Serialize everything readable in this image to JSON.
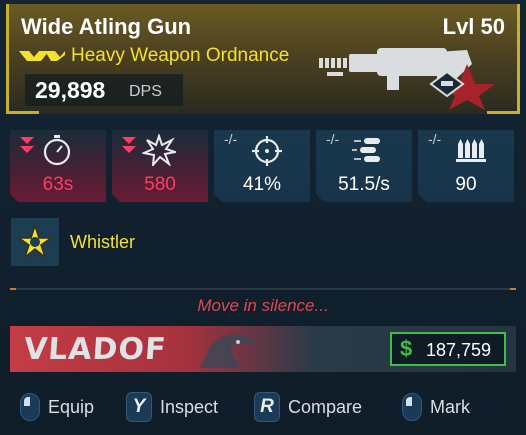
{
  "item": {
    "name": "Wide Atling Gun",
    "level": "Lvl 50",
    "type": "Heavy Weapon Ordnance",
    "dps_value": "29,898",
    "dps_unit": "DPS",
    "rarity_color": "#f2e12e"
  },
  "stats": [
    {
      "icon": "stopwatch-icon",
      "indicator": "down-arrows",
      "value": "63s"
    },
    {
      "icon": "burst-icon",
      "indicator": "down-arrows",
      "value": "580"
    },
    {
      "icon": "crosshair-icon",
      "indicator": "-/-",
      "value": "41%"
    },
    {
      "icon": "rockets-icon",
      "indicator": "-/-",
      "value": "51.5/s"
    },
    {
      "icon": "ammo-icon",
      "indicator": "-/-",
      "value": "90"
    }
  ],
  "perk": {
    "icon": "star-badge-icon",
    "name": "Whistler"
  },
  "flavor_text": "Move in silence...",
  "manufacturer": {
    "name": "VLADOF",
    "price_symbol": "$",
    "price": "187,759"
  },
  "actions": [
    {
      "key": "mouse",
      "label": "Equip"
    },
    {
      "key": "Y",
      "label": "Inspect"
    },
    {
      "key": "R",
      "label": "Compare"
    },
    {
      "key": "mouse",
      "label": "Mark"
    }
  ],
  "colors": {
    "bad_stat": "#ff3d63",
    "price_accent": "#3fbf47",
    "flavor": "#e0474f",
    "header_border": "#c7b12a"
  }
}
